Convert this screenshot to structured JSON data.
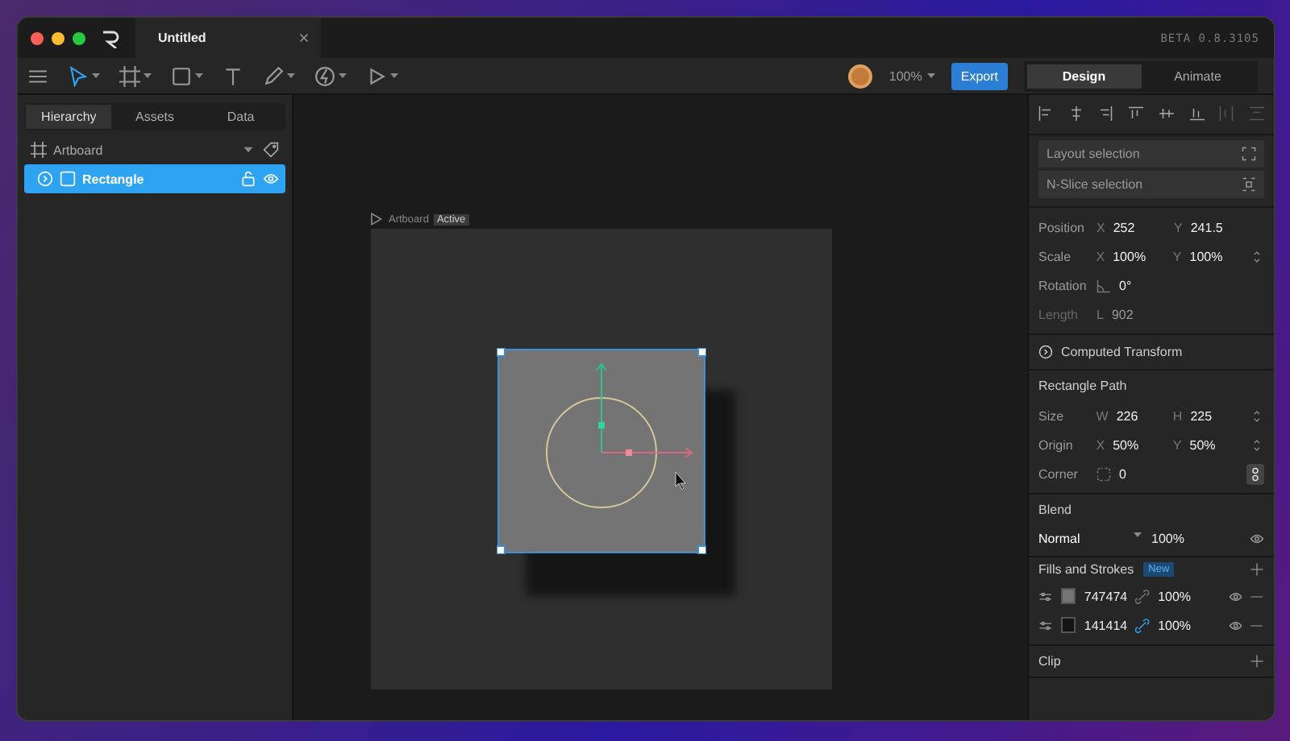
{
  "window": {
    "title": "Untitled",
    "version": "BETA 0.8.3105"
  },
  "toolbar": {
    "zoom": "100%",
    "export": "Export",
    "modes": [
      {
        "label": "Design",
        "selected": true
      },
      {
        "label": "Animate",
        "selected": false
      }
    ]
  },
  "left_panel": {
    "tabs": [
      {
        "label": "Hierarchy",
        "selected": true
      },
      {
        "label": "Assets",
        "selected": false
      },
      {
        "label": "Data",
        "selected": false
      }
    ],
    "layers": [
      {
        "name": "Artboard",
        "kind": "artboard",
        "selected": false,
        "children": [
          {
            "name": "Rectangle",
            "kind": "rectangle",
            "selected": true
          }
        ]
      }
    ]
  },
  "canvas": {
    "artboard_label": "Artboard",
    "badge": "Active"
  },
  "inspector": {
    "selections": [
      "Layout selection",
      "N-Slice selection"
    ],
    "transform": [
      {
        "label": "Position",
        "disabled": false,
        "stepper": false,
        "link_button": false,
        "fields": [
          {
            "kind": "letter",
            "prefix": "X",
            "value": "252"
          },
          {
            "kind": "letter",
            "prefix": "Y",
            "value": "241.5"
          }
        ]
      },
      {
        "label": "Scale",
        "disabled": false,
        "stepper": true,
        "link_button": false,
        "fields": [
          {
            "kind": "letter",
            "prefix": "X",
            "value": "100%"
          },
          {
            "kind": "letter",
            "prefix": "Y",
            "value": "100%"
          }
        ]
      },
      {
        "label": "Rotation",
        "disabled": false,
        "stepper": false,
        "link_button": false,
        "fields": [
          {
            "kind": "angle",
            "value": "0°"
          }
        ]
      },
      {
        "label": "Length",
        "disabled": true,
        "stepper": false,
        "link_button": false,
        "fields": [
          {
            "kind": "letter",
            "prefix": "L",
            "value": "902"
          }
        ]
      }
    ],
    "computed": "Computed Transform",
    "path": {
      "title": "Rectangle Path",
      "rows": [
        {
          "label": "Size",
          "disabled": false,
          "stepper": true,
          "link_button": false,
          "fields": [
            {
              "kind": "letter",
              "prefix": "W",
              "value": "226"
            },
            {
              "kind": "letter",
              "prefix": "H",
              "value": "225"
            }
          ]
        },
        {
          "label": "Origin",
          "disabled": false,
          "stepper": true,
          "link_button": false,
          "fields": [
            {
              "kind": "letter",
              "prefix": "X",
              "value": "50%"
            },
            {
              "kind": "letter",
              "prefix": "Y",
              "value": "50%"
            }
          ]
        },
        {
          "label": "Corner",
          "disabled": false,
          "stepper": false,
          "link_button": true,
          "fields": [
            {
              "kind": "corner",
              "value": "0"
            }
          ]
        }
      ]
    },
    "blend": {
      "title": "Blend",
      "mode": "Normal",
      "opacity": "100%"
    },
    "fills": {
      "title": "Fills and Strokes",
      "badge": "New",
      "items": [
        {
          "hex": "747474",
          "color": "#747474",
          "opacity": "100%",
          "linked": false
        },
        {
          "hex": "141414",
          "color": "#141414",
          "opacity": "100%",
          "linked": true
        }
      ]
    },
    "clip": {
      "title": "Clip"
    }
  }
}
